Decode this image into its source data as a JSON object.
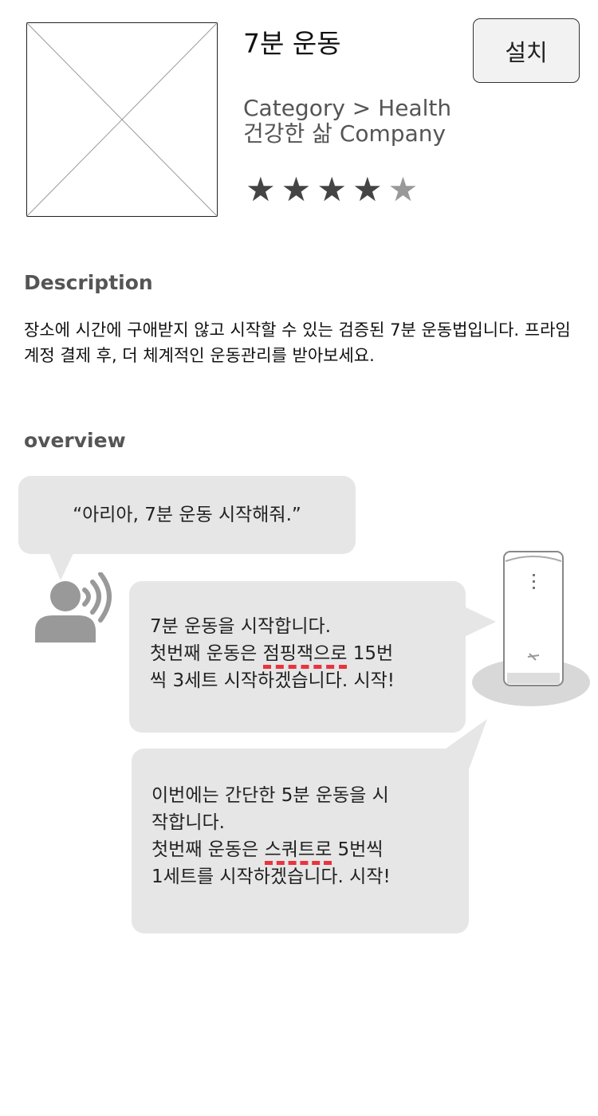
{
  "app": {
    "title": "7분 운동",
    "install_label": "설치",
    "category": "Category > Health",
    "company": "건강한 삶 Company",
    "rating": {
      "value": 4.5,
      "max": 5,
      "star_glyph": "★"
    },
    "icon": "image-placeholder-icon"
  },
  "description": {
    "title": "Description",
    "text": "장소에 시간에 구애받지 않고 시작할 수 있는 검증된 7분 운동법입니다. 프라임 계정 결제 후, 더 체계적인 운동관리를 받아보세요."
  },
  "overview": {
    "title": "overview",
    "user_utterance": "“아리아, 7분 운동 시작해줘.”",
    "reply1": {
      "line1": "7분 운동을 시작합니다.",
      "line2_pre": "첫번째 운동은 ",
      "line2_hl": "점핑잭으로",
      "line2_post": " 15번",
      "line3": "씩 3세트 시작하겠습니다. 시작!"
    },
    "reply2": {
      "line1": "이번에는 간단한 5분 운동을 시",
      "line2": "작합니다.",
      "line3_pre": "첫번째 운동은 ",
      "line3_hl": "스쿼트로",
      "line3_post": " 5번씩",
      "line4": "1세트를 시작하겠습니다. 시작!"
    },
    "highlight_color": "#e8343f",
    "bubble_color": "#e6e6e6",
    "icons": [
      "user-speaking-icon",
      "smart-speaker-icon"
    ]
  }
}
